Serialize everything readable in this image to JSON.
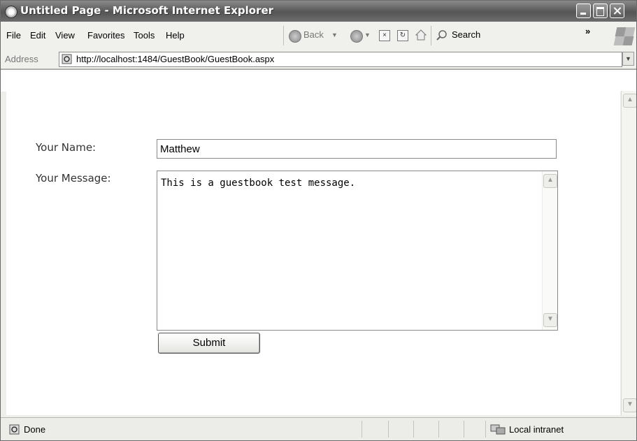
{
  "window": {
    "title": "Untitled Page - Microsoft Internet Explorer"
  },
  "menu": {
    "items": [
      "File",
      "Edit",
      "View",
      "Favorites",
      "Tools",
      "Help"
    ],
    "back_label": "Back",
    "search_label": "Search",
    "overflow": "»"
  },
  "address": {
    "label": "Address",
    "url": "http://localhost:1484/GuestBook/GuestBook.aspx"
  },
  "form": {
    "name_label": "Your Name:",
    "name_value": "Matthew",
    "message_label": "Your Message:",
    "message_value": "This is a guestbook test message.",
    "submit_label": "Submit"
  },
  "status": {
    "text": "Done",
    "zone": "Local intranet"
  }
}
